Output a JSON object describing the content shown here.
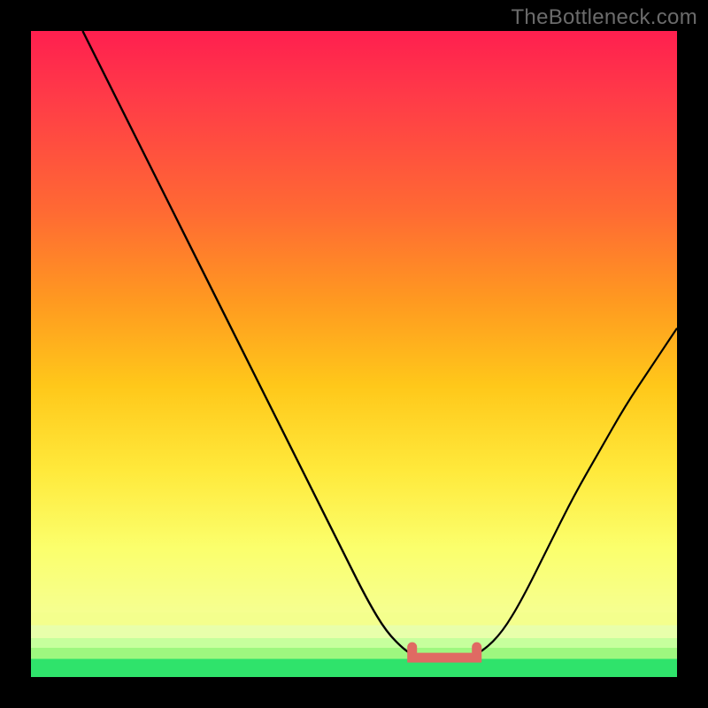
{
  "watermark": "TheBottleneck.com",
  "colors": {
    "frame": "#000000",
    "watermark": "#6b6b6b",
    "curve": "#000000",
    "valley_marker": "#e06a63",
    "gradient_top": "#ff1f4f",
    "gradient_mid1": "#ff9a20",
    "gradient_mid2": "#ffe93b",
    "gradient_pale": "#f6ff90",
    "gradient_green": "#2fe36b"
  },
  "chart_data": {
    "type": "line",
    "title": "",
    "xlabel": "",
    "ylabel": "",
    "xlim": [
      0,
      100
    ],
    "ylim": [
      0,
      100
    ],
    "grid": false,
    "legend": false,
    "series": [
      {
        "name": "bottleneck-curve-left",
        "x": [
          8,
          12,
          16,
          20,
          24,
          28,
          32,
          36,
          40,
          44,
          48,
          52,
          55,
          58,
          60
        ],
        "values": [
          100,
          92,
          84,
          76,
          68,
          60,
          52,
          44,
          36,
          28,
          20,
          12,
          7,
          4,
          3
        ]
      },
      {
        "name": "bottleneck-curve-right",
        "x": [
          68,
          70,
          73,
          76,
          80,
          84,
          88,
          92,
          96,
          100
        ],
        "values": [
          3,
          4,
          7,
          12,
          20,
          28,
          35,
          42,
          48,
          54
        ]
      },
      {
        "name": "valley-flat",
        "x": [
          60,
          62,
          64,
          66,
          68
        ],
        "values": [
          3,
          3,
          3,
          3,
          3
        ]
      }
    ],
    "annotations": [
      {
        "name": "valley-marker",
        "type": "segment",
        "style": "thick-red-rounded",
        "x": [
          59,
          69
        ],
        "y": [
          3,
          3
        ]
      }
    ],
    "background_gradient": {
      "direction": "vertical",
      "stops": [
        {
          "pos": 0,
          "color": "#ff1f4f"
        },
        {
          "pos": 0.28,
          "color": "#ff6a33"
        },
        {
          "pos": 0.55,
          "color": "#ffc81a"
        },
        {
          "pos": 0.8,
          "color": "#fbff6c"
        },
        {
          "pos": 0.9,
          "color": "#f6ff90"
        },
        {
          "pos": 0.97,
          "color": "#9ef77f"
        },
        {
          "pos": 1.0,
          "color": "#2fe36b"
        }
      ]
    }
  }
}
